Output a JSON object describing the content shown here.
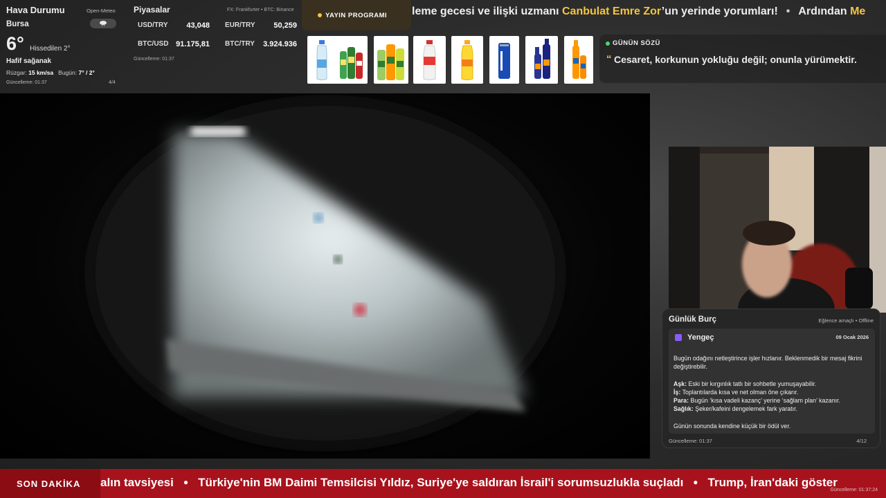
{
  "weather": {
    "title": "Hava Durumu",
    "source": "Open-Meteo",
    "city": "Bursa",
    "icon": "cloud-rain-icon",
    "temperature": "6°",
    "feels_like": "Hissedilen 2°",
    "condition": "Hafif sağanak",
    "wind_label": "Rüzgar:",
    "wind_value": "15 km/sa",
    "today_label": "Bugün:",
    "today_value": "7° / 2°",
    "updated": "Güncelleme: 01:37",
    "page": "4/4"
  },
  "markets": {
    "title": "Piyasalar",
    "source": "FX: Frankfurter • BTC: Binance",
    "items": [
      {
        "label": "USD/TRY",
        "value": "43,048"
      },
      {
        "label": "EUR/TRY",
        "value": "50,259"
      },
      {
        "label": "BTC/USD",
        "value": "91.175,81"
      },
      {
        "label": "BTC/TRY",
        "value": "3.924.936"
      }
    ],
    "updated": "Güncelleme: 01:37"
  },
  "program": {
    "label": "YAYIN PROGRAMI",
    "accent": "#f4c542"
  },
  "top_ticker": {
    "part1": "leme gecesi ve ilişki uzmanı ",
    "highlight1": "Canbulat Emre Zor",
    "part2": "’un yerinde yorumları!",
    "part3": "Ardından ",
    "highlight2": "Me"
  },
  "products": [
    "water-bottle",
    "soda-bottles-green",
    "soda-bottles-mixed",
    "water-bottle-red-cap",
    "lemon-soda-bottle",
    "blue-can",
    "blue-glass-bottles",
    "orange-soda-bottles"
  ],
  "quote": {
    "label": "GÜNÜN SÖZÜ",
    "mark": "“",
    "text": "Cesaret, korkunun yokluğu değil; onunla yürümektir. ",
    "accent": "#4cd964"
  },
  "horoscope": {
    "title": "Günlük Burç",
    "tag": "Eğlence amaçlı • Offline",
    "sign": "Yengeç",
    "date": "09 Ocak 2026",
    "intro": "Bugün odağını netleştirince işler hızlanır. Beklenmedik bir mesaj fikrini değiştirebilir.",
    "love_label": "Aşk:",
    "love": " Eski bir kırgınlık tatlı bir sohbetle yumuşayabilir.",
    "work_label": "İş:",
    "work": " Toplantılarda kısa ve net olman öne çıkarır.",
    "money_label": "Para:",
    "money": " Bugün ‘kısa vadeli kazanç’ yerine ‘sağlam plan’ kazanır.",
    "health_label": "Sağlık:",
    "health": " Şeker/kafeini dengelemek fark yaratır.",
    "closing": "Günün sonunda kendine küçük bir ödül ver.",
    "updated": "Güncelleme: 01:37",
    "page": "4/12",
    "sign_color": "#8a5cf6"
  },
  "news": {
    "badge": "SON DAKİKA",
    "items": [
      "alın tavsiyesi",
      "Türkiye'nin BM Daimi Temsilcisi Yıldız, Suriye'ye saldıran İsrail'i sorumsuzlukla suçladı",
      "Trump, İran'daki göster"
    ],
    "updated": "Güncelleme: 01:37:24",
    "bar_color": "#a8121c"
  }
}
